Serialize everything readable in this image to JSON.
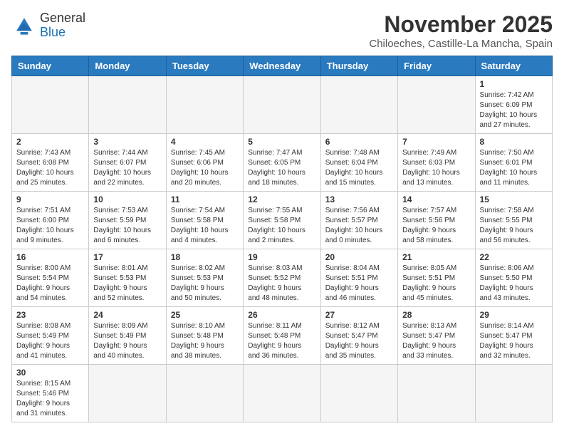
{
  "header": {
    "logo_line1": "General",
    "logo_line2": "Blue",
    "title": "November 2025",
    "subtitle": "Chiloeches, Castille-La Mancha, Spain"
  },
  "weekdays": [
    "Sunday",
    "Monday",
    "Tuesday",
    "Wednesday",
    "Thursday",
    "Friday",
    "Saturday"
  ],
  "days": [
    {
      "date": "",
      "info": ""
    },
    {
      "date": "",
      "info": ""
    },
    {
      "date": "",
      "info": ""
    },
    {
      "date": "",
      "info": ""
    },
    {
      "date": "",
      "info": ""
    },
    {
      "date": "",
      "info": ""
    },
    {
      "date": "1",
      "info": "Sunrise: 7:42 AM\nSunset: 6:09 PM\nDaylight: 10 hours\nand 27 minutes."
    },
    {
      "date": "2",
      "info": "Sunrise: 7:43 AM\nSunset: 6:08 PM\nDaylight: 10 hours\nand 25 minutes."
    },
    {
      "date": "3",
      "info": "Sunrise: 7:44 AM\nSunset: 6:07 PM\nDaylight: 10 hours\nand 22 minutes."
    },
    {
      "date": "4",
      "info": "Sunrise: 7:45 AM\nSunset: 6:06 PM\nDaylight: 10 hours\nand 20 minutes."
    },
    {
      "date": "5",
      "info": "Sunrise: 7:47 AM\nSunset: 6:05 PM\nDaylight: 10 hours\nand 18 minutes."
    },
    {
      "date": "6",
      "info": "Sunrise: 7:48 AM\nSunset: 6:04 PM\nDaylight: 10 hours\nand 15 minutes."
    },
    {
      "date": "7",
      "info": "Sunrise: 7:49 AM\nSunset: 6:03 PM\nDaylight: 10 hours\nand 13 minutes."
    },
    {
      "date": "8",
      "info": "Sunrise: 7:50 AM\nSunset: 6:01 PM\nDaylight: 10 hours\nand 11 minutes."
    },
    {
      "date": "9",
      "info": "Sunrise: 7:51 AM\nSunset: 6:00 PM\nDaylight: 10 hours\nand 9 minutes."
    },
    {
      "date": "10",
      "info": "Sunrise: 7:53 AM\nSunset: 5:59 PM\nDaylight: 10 hours\nand 6 minutes."
    },
    {
      "date": "11",
      "info": "Sunrise: 7:54 AM\nSunset: 5:58 PM\nDaylight: 10 hours\nand 4 minutes."
    },
    {
      "date": "12",
      "info": "Sunrise: 7:55 AM\nSunset: 5:58 PM\nDaylight: 10 hours\nand 2 minutes."
    },
    {
      "date": "13",
      "info": "Sunrise: 7:56 AM\nSunset: 5:57 PM\nDaylight: 10 hours\nand 0 minutes."
    },
    {
      "date": "14",
      "info": "Sunrise: 7:57 AM\nSunset: 5:56 PM\nDaylight: 9 hours\nand 58 minutes."
    },
    {
      "date": "15",
      "info": "Sunrise: 7:58 AM\nSunset: 5:55 PM\nDaylight: 9 hours\nand 56 minutes."
    },
    {
      "date": "16",
      "info": "Sunrise: 8:00 AM\nSunset: 5:54 PM\nDaylight: 9 hours\nand 54 minutes."
    },
    {
      "date": "17",
      "info": "Sunrise: 8:01 AM\nSunset: 5:53 PM\nDaylight: 9 hours\nand 52 minutes."
    },
    {
      "date": "18",
      "info": "Sunrise: 8:02 AM\nSunset: 5:53 PM\nDaylight: 9 hours\nand 50 minutes."
    },
    {
      "date": "19",
      "info": "Sunrise: 8:03 AM\nSunset: 5:52 PM\nDaylight: 9 hours\nand 48 minutes."
    },
    {
      "date": "20",
      "info": "Sunrise: 8:04 AM\nSunset: 5:51 PM\nDaylight: 9 hours\nand 46 minutes."
    },
    {
      "date": "21",
      "info": "Sunrise: 8:05 AM\nSunset: 5:51 PM\nDaylight: 9 hours\nand 45 minutes."
    },
    {
      "date": "22",
      "info": "Sunrise: 8:06 AM\nSunset: 5:50 PM\nDaylight: 9 hours\nand 43 minutes."
    },
    {
      "date": "23",
      "info": "Sunrise: 8:08 AM\nSunset: 5:49 PM\nDaylight: 9 hours\nand 41 minutes."
    },
    {
      "date": "24",
      "info": "Sunrise: 8:09 AM\nSunset: 5:49 PM\nDaylight: 9 hours\nand 40 minutes."
    },
    {
      "date": "25",
      "info": "Sunrise: 8:10 AM\nSunset: 5:48 PM\nDaylight: 9 hours\nand 38 minutes."
    },
    {
      "date": "26",
      "info": "Sunrise: 8:11 AM\nSunset: 5:48 PM\nDaylight: 9 hours\nand 36 minutes."
    },
    {
      "date": "27",
      "info": "Sunrise: 8:12 AM\nSunset: 5:47 PM\nDaylight: 9 hours\nand 35 minutes."
    },
    {
      "date": "28",
      "info": "Sunrise: 8:13 AM\nSunset: 5:47 PM\nDaylight: 9 hours\nand 33 minutes."
    },
    {
      "date": "29",
      "info": "Sunrise: 8:14 AM\nSunset: 5:47 PM\nDaylight: 9 hours\nand 32 minutes."
    },
    {
      "date": "30",
      "info": "Sunrise: 8:15 AM\nSunset: 5:46 PM\nDaylight: 9 hours\nand 31 minutes."
    },
    {
      "date": "",
      "info": ""
    },
    {
      "date": "",
      "info": ""
    },
    {
      "date": "",
      "info": ""
    },
    {
      "date": "",
      "info": ""
    },
    {
      "date": "",
      "info": ""
    },
    {
      "date": "",
      "info": ""
    }
  ]
}
